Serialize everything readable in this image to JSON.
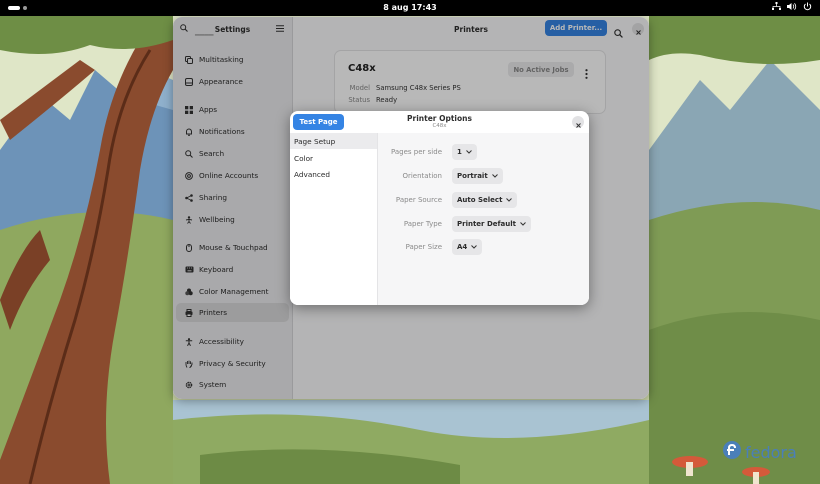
{
  "topbar": {
    "clock": "8 aug  17:43"
  },
  "settings": {
    "sidebar_title": "Settings",
    "sidebar_items": [
      {
        "label": "Multitasking",
        "icon": "multitasking-icon"
      },
      {
        "label": "Appearance",
        "icon": "appearance-icon"
      },
      {
        "label": "Apps",
        "icon": "apps-icon"
      },
      {
        "label": "Notifications",
        "icon": "bell-icon"
      },
      {
        "label": "Search",
        "icon": "search-icon"
      },
      {
        "label": "Online Accounts",
        "icon": "at-icon"
      },
      {
        "label": "Sharing",
        "icon": "share-icon"
      },
      {
        "label": "Wellbeing",
        "icon": "wellbeing-icon"
      },
      {
        "label": "Mouse & Touchpad",
        "icon": "mouse-icon"
      },
      {
        "label": "Keyboard",
        "icon": "keyboard-icon"
      },
      {
        "label": "Color Management",
        "icon": "palette-icon"
      },
      {
        "label": "Printers",
        "icon": "printer-icon",
        "active": true
      },
      {
        "label": "Accessibility",
        "icon": "accessibility-icon"
      },
      {
        "label": "Privacy & Security",
        "icon": "hand-icon"
      },
      {
        "label": "System",
        "icon": "gear-icon"
      }
    ],
    "content_title": "Printers",
    "add_printer_label": "Add Printer...",
    "printer": {
      "name": "C48x",
      "jobs_label": "No Active Jobs",
      "model_key": "Model",
      "model_value": "Samsung C48x Series PS",
      "status_key": "Status",
      "status_value": "Ready"
    }
  },
  "dialog": {
    "test_page_label": "Test Page",
    "title": "Printer Options",
    "subtitle": "C48x",
    "tabs": [
      "Page Setup",
      "Color",
      "Advanced"
    ],
    "options": [
      {
        "label": "Pages per side",
        "value": "1"
      },
      {
        "label": "Orientation",
        "value": "Portrait"
      },
      {
        "label": "Paper Source",
        "value": "Auto Select"
      },
      {
        "label": "Paper Type",
        "value": "Printer Default"
      },
      {
        "label": "Paper Size",
        "value": "A4"
      }
    ]
  },
  "branding": {
    "logo_text": "fedora"
  },
  "colors": {
    "accent": "#3584e4",
    "topbar": "#000000"
  }
}
